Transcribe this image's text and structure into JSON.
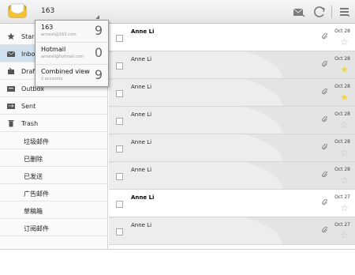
{
  "topbar": {
    "account_name": "163",
    "app_icon": "email-app-icon",
    "compose_icon": "compose-icon",
    "refresh_icon": "refresh-icon",
    "menu_icon": "overflow-menu-icon"
  },
  "accounts": [
    {
      "name": "163",
      "email": "annesli@163.com",
      "count": "9"
    },
    {
      "name": "Hotmail",
      "email": "annesli@hotmail.com",
      "count": "0"
    },
    {
      "name": "Combined view",
      "email": "2 accounts",
      "count": "9"
    }
  ],
  "folders": [
    {
      "label": "Starred",
      "icon": "star-icon"
    },
    {
      "label": "Inbox",
      "icon": "inbox-icon"
    },
    {
      "label": "Drafts",
      "icon": "drafts-icon"
    },
    {
      "label": "Outbox",
      "icon": "outbox-icon"
    },
    {
      "label": "Sent",
      "icon": "sent-icon"
    },
    {
      "label": "Trash",
      "icon": "trash-icon"
    }
  ],
  "subfolders": [
    "垃圾邮件",
    "已删除",
    "已发送",
    "广告邮件",
    "草稿箱",
    "订阅邮件"
  ],
  "messages": [
    {
      "from": "Anne Li",
      "date": "Oct 28",
      "starred": false,
      "unread": true
    },
    {
      "from": "Anne Li",
      "date": "Oct 28",
      "starred": true,
      "unread": false
    },
    {
      "from": "Anne Li",
      "date": "Oct 28",
      "starred": true,
      "unread": false
    },
    {
      "from": "Anne Li",
      "date": "Oct 28",
      "starred": false,
      "unread": false
    },
    {
      "from": "Anne Li",
      "date": "Oct 28",
      "starred": false,
      "unread": false
    },
    {
      "from": "Anne Li",
      "date": "Oct 28",
      "starred": false,
      "unread": false
    },
    {
      "from": "Anne Li",
      "date": "Oct 27",
      "starred": false,
      "unread": true
    },
    {
      "from": "Anne Li",
      "date": "Oct 27",
      "starred": false,
      "unread": false
    }
  ],
  "colors": {
    "selected_folder": "#cfe0ee",
    "read_row": "#e4e4e4",
    "star_on": "#f2d44a"
  }
}
